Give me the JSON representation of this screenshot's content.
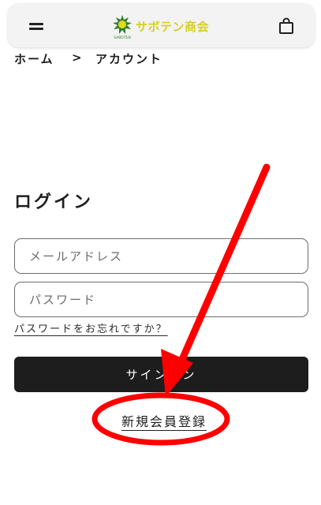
{
  "header": {
    "menu_icon": "hamburger-icon",
    "logo_text": "サボテン商会",
    "logo_subtext": "SABOTEN",
    "cart_icon": "shopping-bag-icon",
    "logo_color": "#d7cf1d"
  },
  "breadcrumb": {
    "home": "ホーム",
    "separator": ">",
    "current": "アカウント"
  },
  "login": {
    "title": "ログイン",
    "email_placeholder": "メールアドレス",
    "password_placeholder": "パスワード",
    "forgot_link": "パスワードをお忘れですか？",
    "signin_button": "サインイン",
    "register_link": "新規会員登録"
  },
  "annotation": {
    "arrow_color": "#ff0000",
    "circle_color": "#ff0000"
  }
}
